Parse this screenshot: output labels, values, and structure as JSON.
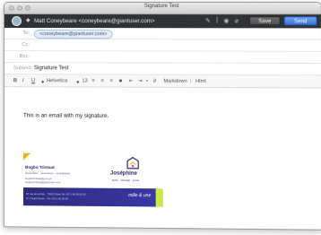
{
  "window": {
    "title": "Signature Test"
  },
  "from": {
    "text": "Matt Coneybeare <coneybeare@giantuser.com>",
    "caret": "◆"
  },
  "toolbar": {
    "save_label": "Save",
    "send_label": "Send"
  },
  "fields": {
    "to_label": "To:",
    "to_chip": "<coneybeare@giantuser.com>",
    "cc_label": "Cc:",
    "bcc_label": "Bcc:",
    "subject_label": "Subject:",
    "subject_value": "Signature Test"
  },
  "format_bar": {
    "bold": "B",
    "italic": "I",
    "underline": "U",
    "font_arrows": "◆",
    "font": "Helvetica",
    "size_arrows": "◆",
    "size": "13",
    "markdown": "Markdown",
    "html": "Html",
    "sep": "|"
  },
  "message": {
    "body": "This is an email with my signature."
  },
  "signature": {
    "name": "Bogbo Trintaat",
    "line1": "Associates · associates · musiglishes",
    "line2": "bogbotrintaat@joseph",
    "line3": "bogbotrintaat@giantuser.com",
    "brand": "Joséphine",
    "tagline": "store · courage · jouez",
    "addr1": "15 rue de la Paix · 75001 Paris Tel +33 1 45 00 00 00",
    "addr2": "N° 2 Saint Denis · Tél +33 1 00 00 00",
    "trade": "mille & une"
  },
  "colors": {
    "toolbar_dark": "#303235",
    "send_blue": "#3a73d8",
    "brand_navy": "#2e2b7d",
    "accent_yellow": "#f0b01a",
    "accent_green": "#cbe64a"
  }
}
